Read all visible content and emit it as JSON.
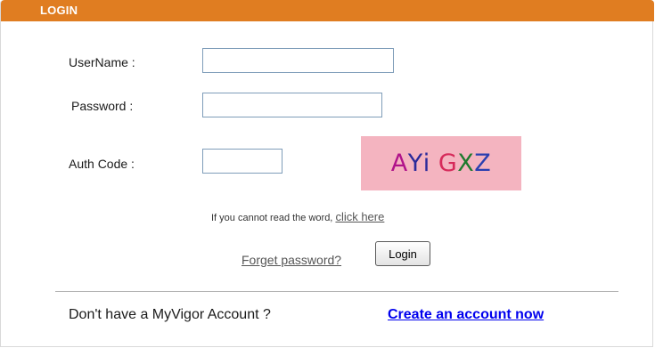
{
  "header": {
    "title": "LOGIN",
    "color": "#e07d21"
  },
  "form": {
    "username": {
      "label": "UserName :",
      "value": "",
      "placeholder": ""
    },
    "password": {
      "label": "Password :",
      "value": "",
      "placeholder": ""
    },
    "auth_code": {
      "label": "Auth Code :",
      "value": "",
      "placeholder": ""
    }
  },
  "captcha": {
    "background": "#f4b4c0",
    "chars": [
      {
        "ch": "A",
        "color": "#b0128a"
      },
      {
        "ch": "Y",
        "color": "#2a2a9a"
      },
      {
        "ch": "i",
        "color": "#2a2a9a"
      },
      {
        "ch": " ",
        "color": "#000000"
      },
      {
        "ch": "G",
        "color": "#d62a5a"
      },
      {
        "ch": "X",
        "color": "#1e7a2e"
      },
      {
        "ch": "Z",
        "color": "#2a3fb0"
      }
    ]
  },
  "captcha_hint": {
    "text": "If you cannot read the word,",
    "link": "click here"
  },
  "actions": {
    "forgot_password": "Forget password?",
    "login_button": "Login"
  },
  "signup": {
    "prompt": "Don't have a MyVigor Account ?",
    "link": "Create an account now",
    "link_color": "#0000ee"
  }
}
